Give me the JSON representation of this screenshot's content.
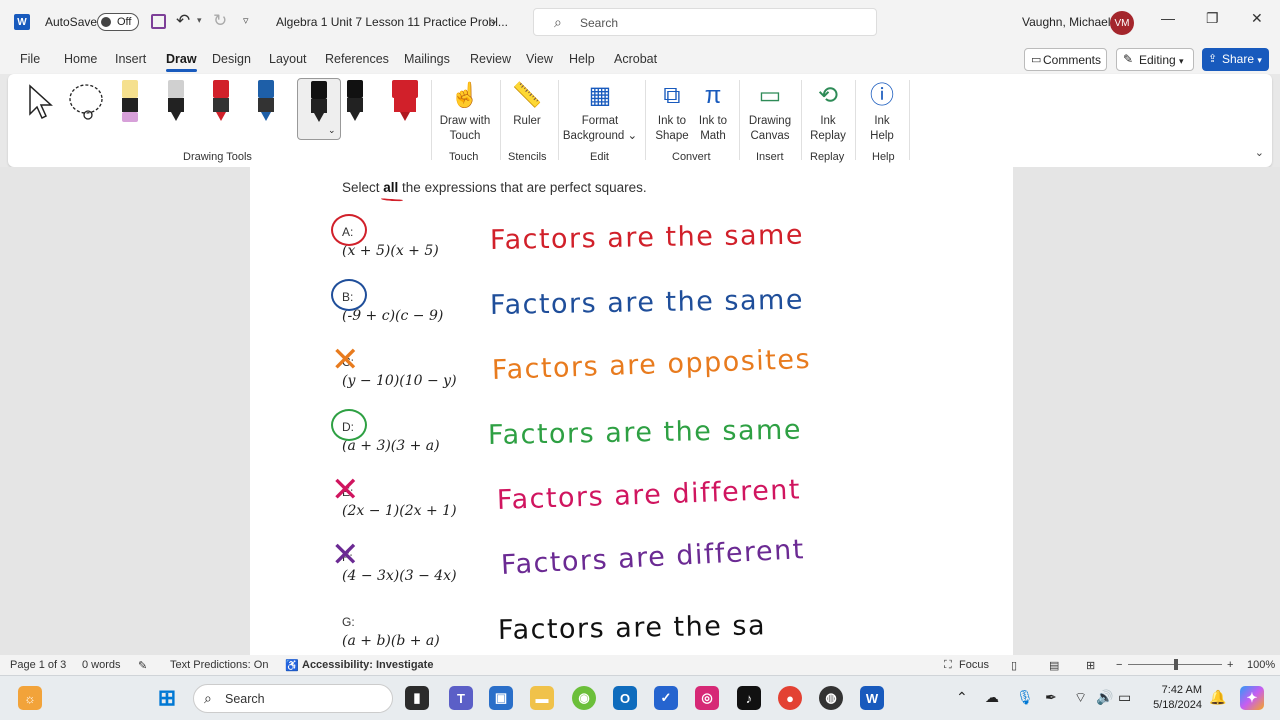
{
  "titlebar": {
    "autosave_label": "AutoSave",
    "autosave_state": "Off",
    "doc_title": "Algebra 1 Unit 7 Lesson 11 Practice Probl...",
    "search_placeholder": "Search",
    "user_name": "Vaughn, Michael",
    "user_initials": "VM"
  },
  "tabs": [
    "File",
    "Home",
    "Insert",
    "Draw",
    "Design",
    "Layout",
    "References",
    "Mailings",
    "Review",
    "View",
    "Help",
    "Acrobat"
  ],
  "active_tab": "Draw",
  "actions": {
    "comments": "Comments",
    "editing": "Editing",
    "share": "Share"
  },
  "ribbon": {
    "groups": {
      "drawing_tools": "Drawing Tools",
      "touch": "Touch",
      "stencils": "Stencils",
      "edit": "Edit",
      "convert": "Convert",
      "insert": "Insert",
      "replay": "Replay",
      "help": "Help"
    },
    "buttons": {
      "draw_with_touch_1": "Draw with",
      "draw_with_touch_2": "Touch",
      "ruler": "Ruler",
      "format_bg_1": "Format",
      "format_bg_2": "Background",
      "ink_to_shape_1": "Ink to",
      "ink_to_shape_2": "Shape",
      "ink_to_math_1": "Ink to",
      "ink_to_math_2": "Math",
      "drawing_canvas_1": "Drawing",
      "drawing_canvas_2": "Canvas",
      "ink_replay_1": "Ink",
      "ink_replay_2": "Replay",
      "ink_help_1": "Ink",
      "ink_help_2": "Help"
    },
    "pen_colors": [
      "#f5e08e",
      "#d0d0d0",
      "#d1202a",
      "#1e5fa8",
      "#111111",
      "#111111",
      "#d1202a"
    ]
  },
  "document": {
    "instruction_pre": "Select ",
    "instruction_bold": "all",
    "instruction_post": " the expressions that are perfect squares.",
    "options": [
      {
        "letter": "A:",
        "expr": "(x + 5)(x + 5)",
        "ink": "Factors are the same",
        "color": "#d1202a",
        "mark": "circle"
      },
      {
        "letter": "B:",
        "expr": "(-9 + c)(c − 9)",
        "ink": "Factors are the same",
        "color": "#1f4e9a",
        "mark": "circle"
      },
      {
        "letter": "C:",
        "expr": "(y − 10)(10 − y)",
        "ink": "Factors are opposites",
        "color": "#e87b1e",
        "mark": "x"
      },
      {
        "letter": "D:",
        "expr": "(a + 3)(3 + a)",
        "ink": "Factors are the same",
        "color": "#2ea043",
        "mark": "circle"
      },
      {
        "letter": "E:",
        "expr": "(2x − 1)(2x + 1)",
        "ink": "Factors are different",
        "color": "#d0155f",
        "mark": "x"
      },
      {
        "letter": "F:",
        "expr": "(4 − 3x)(3 − 4x)",
        "ink": "Factors are different",
        "color": "#6b2a93",
        "mark": "x"
      },
      {
        "letter": "G:",
        "expr": "(a + b)(b + a)",
        "ink": "Factors are the sa",
        "color": "#111111",
        "mark": "none"
      }
    ]
  },
  "status": {
    "page": "Page 1 of 3",
    "words": "0 words",
    "predictions": "Text Predictions: On",
    "accessibility": "Accessibility: Investigate",
    "focus": "Focus",
    "zoom": "100%"
  },
  "taskbar": {
    "search_placeholder": "Search",
    "time": "7:42 AM",
    "date": "5/18/2024"
  }
}
